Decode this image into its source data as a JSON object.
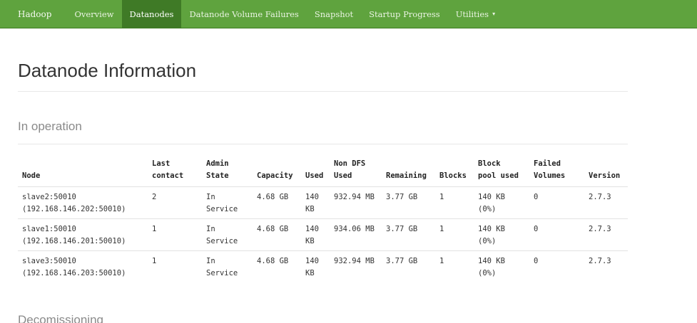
{
  "nav": {
    "brand": "Hadoop",
    "items": [
      {
        "label": "Overview",
        "active": false
      },
      {
        "label": "Datanodes",
        "active": true
      },
      {
        "label": "Datanode Volume Failures",
        "active": false
      },
      {
        "label": "Snapshot",
        "active": false
      },
      {
        "label": "Startup Progress",
        "active": false
      },
      {
        "label": "Utilities",
        "active": false
      }
    ],
    "caret": "▾"
  },
  "page": {
    "title": "Datanode Information",
    "section_in_operation": "In operation",
    "section_decommissioning": "Decomissioning"
  },
  "table": {
    "headers": {
      "node": "Node",
      "last_contact": [
        "Last",
        "contact"
      ],
      "admin_state": [
        "Admin",
        "State"
      ],
      "capacity": "Capacity",
      "used": "Used",
      "non_dfs_used": [
        "Non DFS",
        "Used"
      ],
      "remaining": "Remaining",
      "blocks": "Blocks",
      "block_pool_used": [
        "Block",
        "pool used"
      ],
      "failed_volumes": [
        "Failed",
        "Volumes"
      ],
      "version": "Version"
    },
    "rows": [
      {
        "node": "slave2:50010",
        "addr": "(192.168.146.202:50010)",
        "last_contact": "2",
        "admin": [
          "In",
          "Service"
        ],
        "capacity": "4.68 GB",
        "used": [
          "140",
          "KB"
        ],
        "non_dfs": "932.94 MB",
        "remaining": "3.77 GB",
        "blocks": "1",
        "bpool": "140 KB (0%)",
        "failed": "0",
        "version": "2.7.3"
      },
      {
        "node": "slave1:50010",
        "addr": "(192.168.146.201:50010)",
        "last_contact": "1",
        "admin": [
          "In",
          "Service"
        ],
        "capacity": "4.68 GB",
        "used": [
          "140",
          "KB"
        ],
        "non_dfs": "934.06 MB",
        "remaining": "3.77 GB",
        "blocks": "1",
        "bpool": "140 KB (0%)",
        "failed": "0",
        "version": "2.7.3"
      },
      {
        "node": "slave3:50010",
        "addr": "(192.168.146.203:50010)",
        "last_contact": "1",
        "admin": [
          "In",
          "Service"
        ],
        "capacity": "4.68 GB",
        "used": [
          "140",
          "KB"
        ],
        "non_dfs": "932.94 MB",
        "remaining": "3.77 GB",
        "blocks": "1",
        "bpool": "140 KB (0%)",
        "failed": "0",
        "version": "2.7.3"
      }
    ]
  }
}
